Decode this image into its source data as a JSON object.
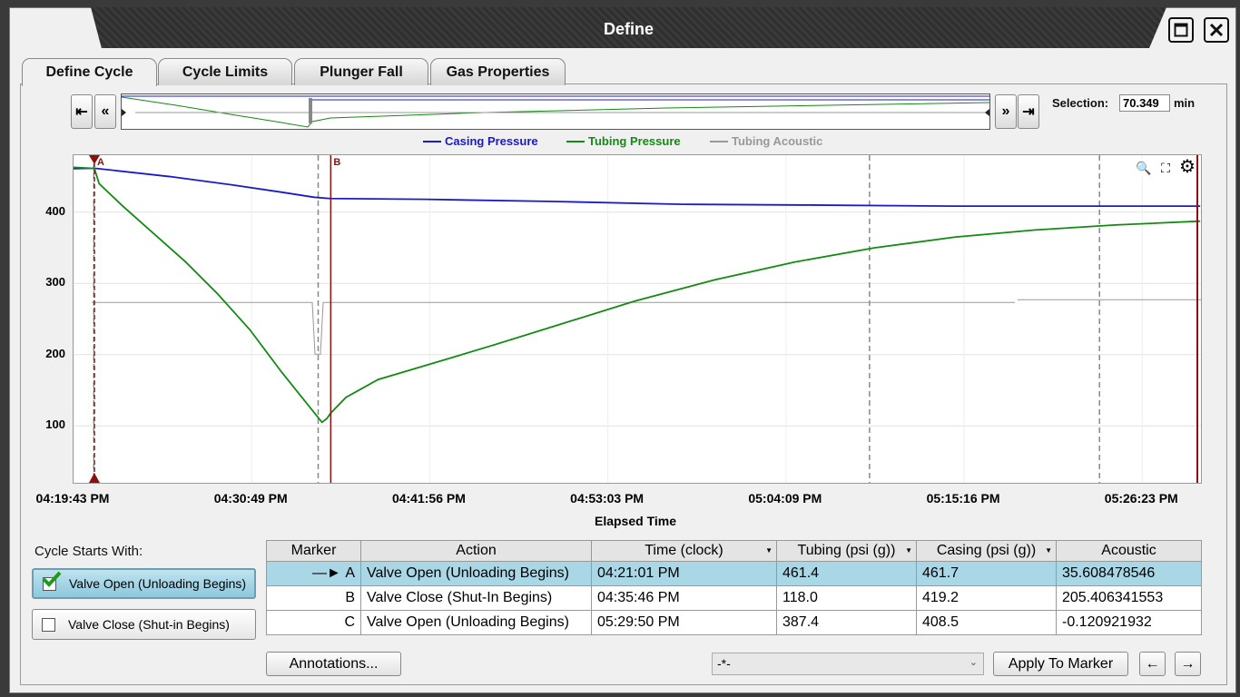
{
  "window": {
    "title": "Define"
  },
  "tabs": [
    "Define Cycle",
    "Cycle Limits",
    "Plunger Fall",
    "Gas Properties"
  ],
  "selection": {
    "label": "Selection:",
    "value": "70.349",
    "unit": "min"
  },
  "legend": [
    {
      "name": "Casing Pressure",
      "color": "#1a1acc"
    },
    {
      "name": "Tubing Pressure",
      "color": "#138a13"
    },
    {
      "name": "Tubing Acoustic",
      "color": "#999999"
    }
  ],
  "chart_data": {
    "type": "line",
    "xlabel": "Elapsed Time",
    "x_tick_labels": [
      "04:19:43 PM",
      "04:30:49 PM",
      "04:41:56 PM",
      "04:53:03 PM",
      "05:04:09 PM",
      "05:15:16 PM",
      "05:26:23 PM"
    ],
    "y_ticks": [
      100,
      200,
      300,
      400
    ],
    "ylim": [
      20,
      480
    ],
    "xlim_minutes": [
      0,
      70.35
    ],
    "markers": [
      {
        "label": "A",
        "t": 1.3
      },
      {
        "label": "B",
        "t": 16.05
      }
    ],
    "series": [
      {
        "name": "Casing Pressure",
        "color": "#1a1acc",
        "points": [
          [
            0,
            461
          ],
          [
            1.3,
            461.7
          ],
          [
            6,
            450
          ],
          [
            10,
            438
          ],
          [
            13,
            428
          ],
          [
            15,
            421
          ],
          [
            16,
            419.2
          ],
          [
            22,
            418
          ],
          [
            30,
            415
          ],
          [
            38,
            411
          ],
          [
            46,
            410
          ],
          [
            55,
            408.5
          ],
          [
            62,
            408.5
          ],
          [
            70.3,
            408.5
          ]
        ]
      },
      {
        "name": "Tubing Pressure",
        "color": "#138a13",
        "points": [
          [
            0,
            463
          ],
          [
            1.3,
            461.4
          ],
          [
            1.6,
            440
          ],
          [
            3,
            410
          ],
          [
            5,
            370
          ],
          [
            7,
            330
          ],
          [
            9,
            285
          ],
          [
            11,
            235
          ],
          [
            13,
            175
          ],
          [
            15.5,
            105
          ],
          [
            15.8,
            110
          ],
          [
            16.05,
            118
          ],
          [
            17,
            140
          ],
          [
            19,
            165
          ],
          [
            22,
            185
          ],
          [
            26,
            212
          ],
          [
            30,
            240
          ],
          [
            35,
            275
          ],
          [
            40,
            305
          ],
          [
            45,
            330
          ],
          [
            50,
            350
          ],
          [
            55,
            365
          ],
          [
            60,
            375
          ],
          [
            65,
            382
          ],
          [
            70.3,
            387.4
          ]
        ]
      },
      {
        "name": "Tubing Acoustic",
        "color": "#999999",
        "points": [
          [
            0,
            277
          ],
          [
            70.3,
            277
          ]
        ]
      }
    ]
  },
  "cycle_start": {
    "label": "Cycle Starts With:",
    "options": [
      "Valve Open (Unloading Begins)",
      "Valve Close (Shut-in Begins)"
    ],
    "selected": 0
  },
  "table": {
    "headers": [
      "Marker",
      "Action",
      "Time (clock)",
      "Tubing (psi (g))",
      "Casing (psi (g))",
      "Acoustic"
    ],
    "rows": [
      {
        "marker": "A",
        "action": "Valve Open (Unloading Begins)",
        "time": "04:21:01 PM",
        "tubing": "461.4",
        "casing": "461.7",
        "acoustic": "35.608478546"
      },
      {
        "marker": "B",
        "action": "Valve Close (Shut-In Begins)",
        "time": "04:35:46 PM",
        "tubing": "118.0",
        "casing": "419.2",
        "acoustic": "205.406341553"
      },
      {
        "marker": "C",
        "action": "Valve Open (Unloading Begins)",
        "time": "05:29:50 PM",
        "tubing": "387.4",
        "casing": "408.5",
        "acoustic": "-0.120921932"
      }
    ],
    "selected_row": 0
  },
  "buttons": {
    "annotations": "Annotations...",
    "dropdown_value": "-*-",
    "apply": "Apply To Marker"
  }
}
